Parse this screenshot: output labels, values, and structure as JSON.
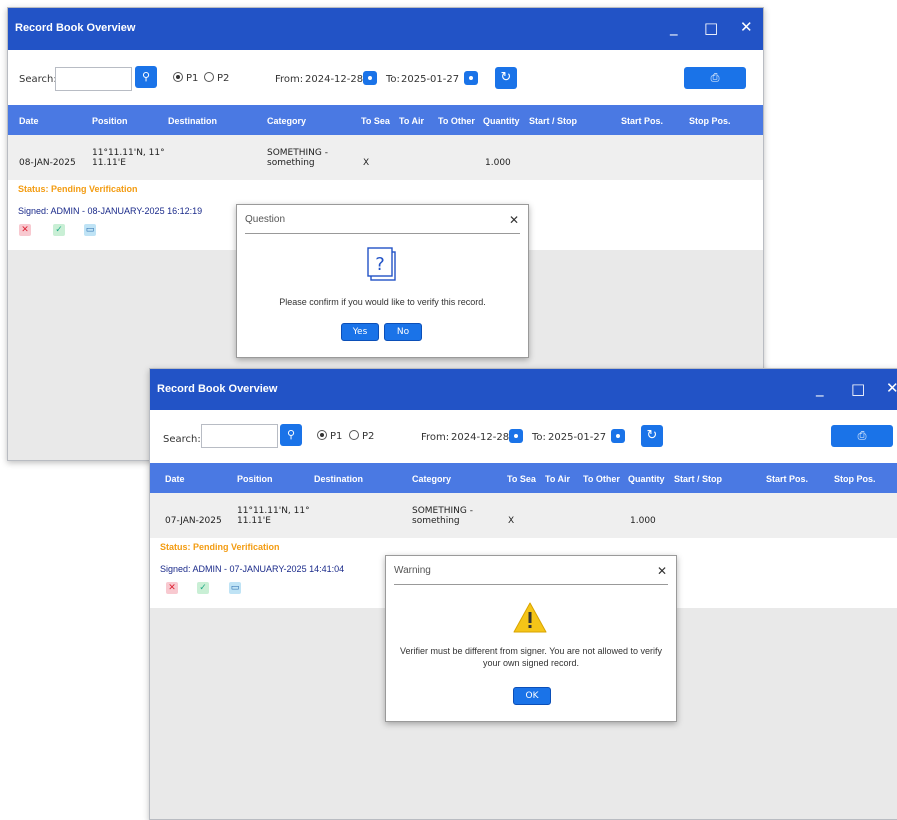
{
  "window1": {
    "title": "Record Book Overview",
    "search_label": "Search:",
    "radio_p1": "P1",
    "radio_p2": "P2",
    "from_label": "From:",
    "from_date": "2024-12-28",
    "to_label": "To:",
    "to_date": "2025-01-27",
    "columns": [
      "Date",
      "Position",
      "Destination",
      "Category",
      "To Sea",
      "To Air",
      "To Other",
      "Quantity",
      "Start / Stop",
      "Start Pos.",
      "Stop Pos."
    ],
    "row": {
      "date": "08-JAN-2025",
      "position_line1": "11°11.11'N, 11°",
      "position_line2": "11.11'E",
      "category_line1": "SOMETHING -",
      "category_line2": "something",
      "to_sea": "X",
      "quantity": "1.000"
    },
    "status": "Status: Pending Verification",
    "signed": "Signed: ADMIN - 08-JANUARY-2025 16:12:19",
    "dialog": {
      "title": "Question",
      "message": "Please confirm if you would like to verify this record.",
      "yes": "Yes",
      "no": "No",
      "icon": "question-document-icon"
    }
  },
  "window2": {
    "title": "Record Book Overview",
    "search_label": "Search:",
    "radio_p1": "P1",
    "radio_p2": "P2",
    "from_label": "From:",
    "from_date": "2024-12-28",
    "to_label": "To:",
    "to_date": "2025-01-27",
    "columns": [
      "Date",
      "Position",
      "Destination",
      "Category",
      "To Sea",
      "To Air",
      "To Other",
      "Quantity",
      "Start / Stop",
      "Start Pos.",
      "Stop Pos."
    ],
    "row": {
      "date": "07-JAN-2025",
      "position_line1": "11°11.11'N, 11°",
      "position_line2": "11.11'E",
      "category_line1": "SOMETHING -",
      "category_line2": "something",
      "to_sea": "X",
      "quantity": "1.000"
    },
    "status": "Status: Pending Verification",
    "signed": "Signed: ADMIN - 07-JANUARY-2025 14:41:04",
    "dialog": {
      "title": "Warning",
      "message_line1": "Verifier must be different from signer. You are not allowed to verify",
      "message_line2": "your own signed record.",
      "ok": "OK",
      "icon": "warning-triangle-icon"
    }
  },
  "colors": {
    "titlebar": "#2253c6",
    "table_header": "#4a79e3",
    "button": "#1a73e8",
    "status": "#f39c12",
    "signed": "#1a2a8a"
  }
}
